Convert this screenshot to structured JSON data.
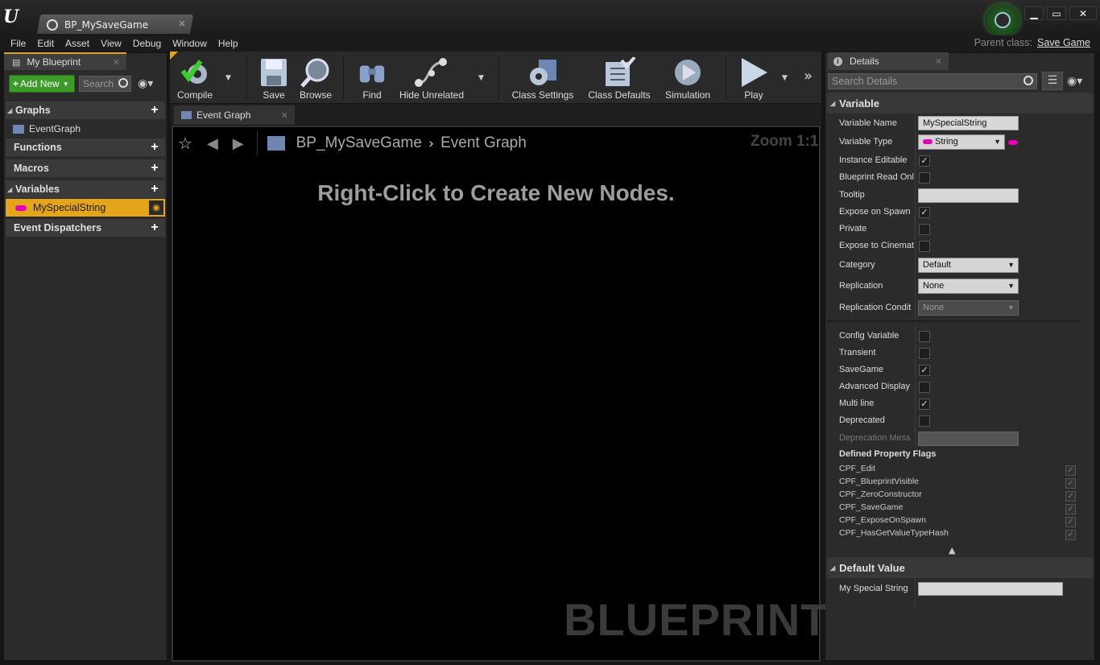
{
  "window": {
    "tab_title": "BP_MySaveGame",
    "tab_close": "×",
    "controls": [
      "▁",
      "▭",
      "✕"
    ],
    "parent_class_label": "Parent class:",
    "parent_class_value": "Save Game"
  },
  "menu": [
    "File",
    "Edit",
    "Asset",
    "View",
    "Debug",
    "Window",
    "Help"
  ],
  "my_blueprint": {
    "tab_label": "My Blueprint",
    "add_new_label": "Add New",
    "search_placeholder": "Search",
    "sections": [
      {
        "label": "Graphs"
      },
      {
        "label": "Functions"
      },
      {
        "label": "Macros"
      },
      {
        "label": "Variables"
      },
      {
        "label": "Event Dispatchers"
      }
    ],
    "graph_item": "EventGraph",
    "variable_item": "MySpecialString"
  },
  "toolbar": {
    "compile": "Compile",
    "save": "Save",
    "browse": "Browse",
    "find": "Find",
    "hide_unrelated": "Hide Unrelated",
    "class_settings": "Class Settings",
    "class_defaults": "Class Defaults",
    "simulation": "Simulation",
    "play": "Play"
  },
  "graph": {
    "tab_label": "Event Graph",
    "crumb_blueprint": "BP_MySaveGame",
    "crumb_graph": "Event Graph",
    "zoom": "Zoom 1:1",
    "hint": "Right-Click to Create New Nodes.",
    "watermark": "BLUEPRINT"
  },
  "details": {
    "tab_label": "Details",
    "search_placeholder": "Search Details",
    "variable_category": "Variable",
    "props": {
      "variable_name_label": "Variable Name",
      "variable_name_value": "MySpecialString",
      "variable_type_label": "Variable Type",
      "variable_type_value": "String",
      "instance_editable_label": "Instance Editable",
      "blueprint_read_only_label": "Blueprint Read Onl",
      "tooltip_label": "Tooltip",
      "expose_on_spawn_label": "Expose on Spawn",
      "private_label": "Private",
      "expose_to_cinematics_label": "Expose to Cinemat",
      "category_label": "Category",
      "category_value": "Default",
      "replication_label": "Replication",
      "replication_value": "None",
      "replication_condition_label": "Replication Condit",
      "replication_condition_value": "None",
      "config_variable_label": "Config Variable",
      "transient_label": "Transient",
      "savegame_label": "SaveGame",
      "advanced_display_label": "Advanced Display",
      "multi_line_label": "Multi line",
      "deprecated_label": "Deprecated",
      "deprecation_message_label": "Deprecation Mess"
    },
    "checks": {
      "instance_editable": true,
      "blueprint_read_only": false,
      "expose_on_spawn": true,
      "private": false,
      "expose_to_cinematics": false,
      "config_variable": false,
      "transient": false,
      "savegame": true,
      "advanced_display": false,
      "multi_line": true,
      "deprecated": false
    },
    "flags_title": "Defined Property Flags",
    "flags": [
      "CPF_Edit",
      "CPF_BlueprintVisible",
      "CPF_ZeroConstructor",
      "CPF_SaveGame",
      "CPF_ExposeOnSpawn",
      "CPF_HasGetValueTypeHash"
    ],
    "default_value_category": "Default Value",
    "default_value_label": "My Special String",
    "default_value_value": ""
  },
  "colors": {
    "accent": "#e5a51a",
    "add_new": "#3c9a28",
    "string_pin": "#e400b8"
  }
}
